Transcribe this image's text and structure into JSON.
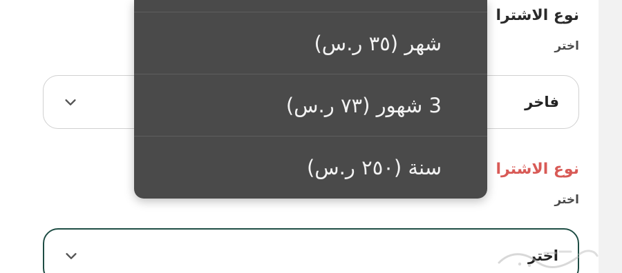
{
  "form": {
    "field1": {
      "title": "نوع الاشترا",
      "hint": "اختر",
      "selected": "فاخر"
    },
    "field2": {
      "title": "نوع الاشترا",
      "hint": "اختر",
      "selected": "اختر"
    }
  },
  "dropdown": {
    "options": [
      "شهر (٣٥ ر.س)",
      "3 شهور (٧٣ ر.س)",
      "سنة (٢٥٠ ر.س)"
    ]
  },
  "icons": {
    "chevron": "chevron-down-icon",
    "watermark": "watermark-logo"
  },
  "colors": {
    "menu_background": "#4a4a4a",
    "required_label": "#d85a56",
    "focus_border": "#1e4d44"
  }
}
